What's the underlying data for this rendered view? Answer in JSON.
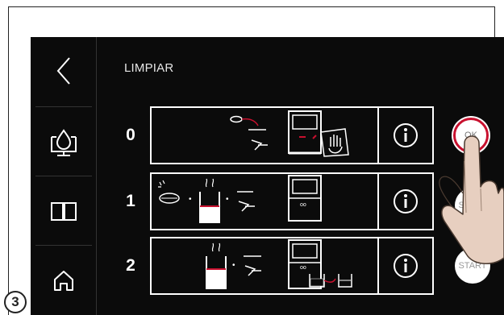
{
  "step_number": "3",
  "screen": {
    "title": "LIMPIAR",
    "accent_color": "#c8102e",
    "background_color": "#0b0b0b"
  },
  "sidebar": {
    "items": [
      {
        "icon": "back-arrow-icon"
      },
      {
        "icon": "water-drop-display-icon"
      },
      {
        "icon": "book-icon"
      },
      {
        "icon": "home-icon"
      }
    ]
  },
  "steps": [
    {
      "number": "0",
      "action_label": "OK"
    },
    {
      "number": "1",
      "action_label": "START"
    },
    {
      "number": "2",
      "action_label": "START"
    }
  ]
}
